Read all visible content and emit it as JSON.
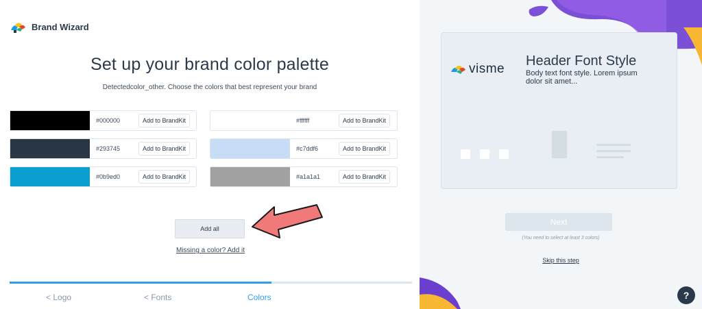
{
  "app": {
    "title": "Brand Wizard"
  },
  "main": {
    "heading": "Set up your brand color palette",
    "subtitle": "Detectedcolor_other. Choose the colors that best represent your brand",
    "add_label": "Add to BrandKit",
    "colors": [
      {
        "hex": "#000000",
        "color": "#000000"
      },
      {
        "hex": "#ffffff",
        "color": "#ffffff"
      },
      {
        "hex": "#293745",
        "color": "#293745"
      },
      {
        "hex": "#c7ddf6",
        "color": "#c7ddf6"
      },
      {
        "hex": "#0b9ed0",
        "color": "#0b9ed0"
      },
      {
        "hex": "#a1a1a1",
        "color": "#a1a1a1"
      }
    ],
    "add_all": "Add all",
    "missing_link": "Missing a color? Add it"
  },
  "steps": {
    "logo": "< Logo",
    "fonts": "< Fonts",
    "colors": "Colors",
    "progress": 0.65
  },
  "preview": {
    "logo_text": "visme",
    "header_text": "Header Font Style",
    "body_text": "Body text font style. Lorem ipsum dolor sit amet..."
  },
  "sidebar": {
    "next": "Next",
    "hint": "(You need to select at least 3 colors)",
    "skip": "Skip this step",
    "help": "?"
  },
  "colors": {
    "accent": "#2d9ff0",
    "dark": "#2b3a4a",
    "arrow": "#f07a7a"
  }
}
